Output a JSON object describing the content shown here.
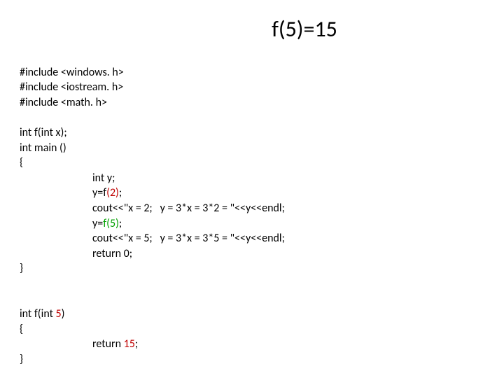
{
  "title": "f(5)=15",
  "code": {
    "inc1": "#include <windows. h>",
    "inc2": "#include <iostream. h>",
    "inc3": "#include <math. h>",
    "blank": "",
    "proto": "int f(int x);",
    "main0": "int main ()",
    "open": "{",
    "m1": "int y;",
    "m2a": "y=f",
    "m2b": "(2)",
    "m2c": ";",
    "m3": "cout<<\"x = 2;   y = 3*x = 3*2 = \"<<y<<endl;",
    "m4a": "y=",
    "m4b": "f(5)",
    "m4c": ";",
    "m5": "cout<<\"x = 5;   y = 3*x = 3*5 = \"<<y<<endl;",
    "m6": "return 0;",
    "close": "}",
    "def0a": "int f(int ",
    "def0b": "5",
    "def0c": ")",
    "ret_a": "return ",
    "ret_b": "15",
    "ret_c": ";"
  }
}
